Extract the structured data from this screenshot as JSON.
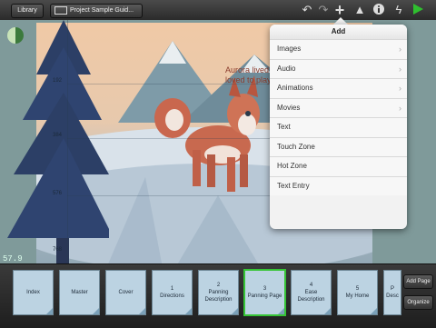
{
  "toolbar": {
    "library_label": "Library",
    "project_label": "Project Sample Guid...",
    "icons": [
      "undo-icon",
      "redo-icon",
      "add-icon",
      "media-icon",
      "info-icon",
      "tools-icon",
      "play-icon"
    ],
    "play_color": "#2fbf2f"
  },
  "canvas": {
    "story_text_line1": "Aurora lived in the mounta",
    "story_text_line2": "loved to play outside and",
    "ruler_labels": [
      "192",
      "384",
      "576",
      "768"
    ],
    "zoom_label": "57.9"
  },
  "add_menu": {
    "title": "Add",
    "items": [
      {
        "label": "Images",
        "has_submenu": true
      },
      {
        "label": "Audio",
        "has_submenu": true
      },
      {
        "label": "Animations",
        "has_submenu": true
      },
      {
        "label": "Movies",
        "has_submenu": true
      },
      {
        "label": "Text",
        "has_submenu": false
      },
      {
        "label": "Touch Zone",
        "has_submenu": false
      },
      {
        "label": "Hot Zone",
        "has_submenu": false
      },
      {
        "label": "Text Entry",
        "has_submenu": false
      }
    ]
  },
  "pages": {
    "items": [
      {
        "line1": "Index",
        "line2": ""
      },
      {
        "line1": "Master",
        "line2": ""
      },
      {
        "line1": "Cover",
        "line2": ""
      },
      {
        "line1": "1",
        "line2": "Directions"
      },
      {
        "line1": "2",
        "line2": "Panning Description"
      },
      {
        "line1": "3",
        "line2": "Panning Page"
      },
      {
        "line1": "4",
        "line2": "Ease Description"
      },
      {
        "line1": "5",
        "line2": "My Home"
      },
      {
        "line1": "P",
        "line2": "Desc"
      }
    ],
    "active_index": 5,
    "add_page_label": "Add Page",
    "organize_label": "Organize",
    "active_color": "#35c435"
  }
}
